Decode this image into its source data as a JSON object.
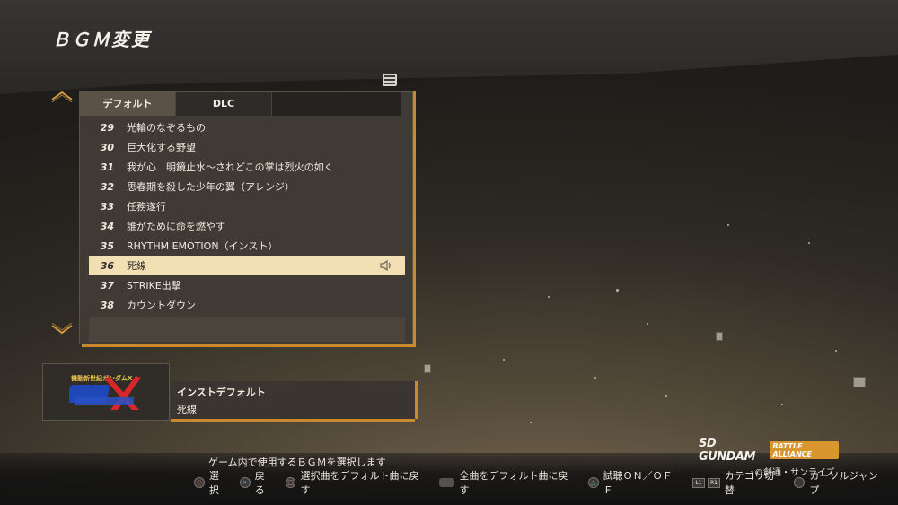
{
  "screen": {
    "title": "ＢＧＭ変更"
  },
  "tabs": [
    {
      "label": "デフォルト",
      "active": true
    },
    {
      "label": "DLC",
      "active": false
    }
  ],
  "tracks": [
    {
      "num": "29",
      "title": "光輪のなぞるもの"
    },
    {
      "num": "30",
      "title": "巨大化する野望"
    },
    {
      "num": "31",
      "title": "我が心　明鏡止水～されどこの掌は烈火の如く"
    },
    {
      "num": "32",
      "title": "思春期を殺した少年の翼（アレンジ）"
    },
    {
      "num": "33",
      "title": "任務遂行"
    },
    {
      "num": "34",
      "title": "誰がために命を燃やす"
    },
    {
      "num": "35",
      "title": "RHYTHM EMOTION（インスト）"
    },
    {
      "num": "36",
      "title": "死線",
      "selected": true
    },
    {
      "num": "37",
      "title": "STRIKE出撃"
    },
    {
      "num": "38",
      "title": "カウントダウン"
    }
  ],
  "info": {
    "logo_text": "機動新世紀ガンダムX",
    "line1": "インストデフォルト",
    "line2": "死線"
  },
  "footer": {
    "hint": "ゲーム内で使用するＢＧＭを選択します",
    "controls": [
      {
        "icon": "circle-button-icon",
        "label": "選択"
      },
      {
        "icon": "cross-button-icon",
        "label": "戻る"
      },
      {
        "icon": "square-button-icon",
        "label": "選択曲をデフォルト曲に戻す"
      },
      {
        "icon": "touchpad-icon",
        "label": "全曲をデフォルト曲に戻す"
      },
      {
        "icon": "triangle-button-icon",
        "label": "試聴ＯＮ／ＯＦＦ"
      },
      {
        "icon": "l1-r1-button-icon",
        "label": "カテゴリ切替"
      },
      {
        "icon": "stick-button-icon",
        "label": "カーソルジャンプ"
      }
    ]
  },
  "branding": {
    "game_logo_main": "SD GUNDAM",
    "game_logo_sub": "BATTLE ALLIANCE",
    "copyright": "©創通・サンライズ"
  },
  "colors": {
    "accent": "#c9892d",
    "selected_row": "#f2dfb4"
  }
}
